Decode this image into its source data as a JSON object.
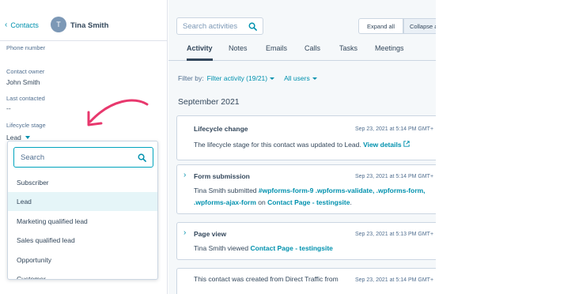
{
  "sidebar": {
    "back_label": "Contacts",
    "avatar_initial": "T",
    "contact_name": "Tina Smith",
    "phone_label": "Phone number",
    "owner_label": "Contact owner",
    "owner_value": "John Smith",
    "last_contacted_label": "Last contacted",
    "last_contacted_value": "--",
    "lifecycle_label": "Lifecycle stage",
    "lifecycle_value": "Lead"
  },
  "dropdown": {
    "search_placeholder": "Search",
    "items": [
      "Subscriber",
      "Lead",
      "Marketing qualified lead",
      "Sales qualified lead",
      "Opportunity",
      "Customer"
    ],
    "selected": "Lead"
  },
  "main": {
    "search_placeholder": "Search activities",
    "expand_all": "Expand all",
    "collapse_all": "Collapse a",
    "tabs": [
      "Activity",
      "Notes",
      "Emails",
      "Calls",
      "Tasks",
      "Meetings"
    ],
    "active_tab": "Activity",
    "filter_label": "Filter by:",
    "filter_activity": "Filter activity (19/21)",
    "filter_users": "All users",
    "month": "September 2021",
    "cards": [
      {
        "title": "Lifecycle change",
        "date": "Sep 23, 2021 at 5:14 PM GMT+",
        "body_prefix": "The lifecycle stage for this contact was updated to Lead.",
        "body_link": "View details"
      },
      {
        "title": "Form submission",
        "date": "Sep 23, 2021 at 5:14 PM GMT+",
        "body_line1_prefix": "Tina Smith submitted",
        "body_line1_link": "#wpforms-form-9 .wpforms-validate, .wpforms-form,",
        "body_line2_link": ".wpforms-ajax-form",
        "body_line2_mid": "on",
        "body_line2_link2": "Contact Page - testingsite",
        "body_line2_end": "."
      },
      {
        "title": "Page view",
        "date": "Sep 23, 2021 at 5:13 PM GMT+",
        "body_prefix": "Tina Smith viewed",
        "body_link": "Contact Page - testingsite"
      },
      {
        "date": "Sep 23, 2021 at 5:14 PM GMT+",
        "body_prefix": "This contact was created from Direct Traffic from"
      }
    ]
  },
  "colors": {
    "accent": "#0091ae",
    "text": "#33475b",
    "arrow": "#e8386d",
    "selected_bg": "#e5f5f8"
  }
}
